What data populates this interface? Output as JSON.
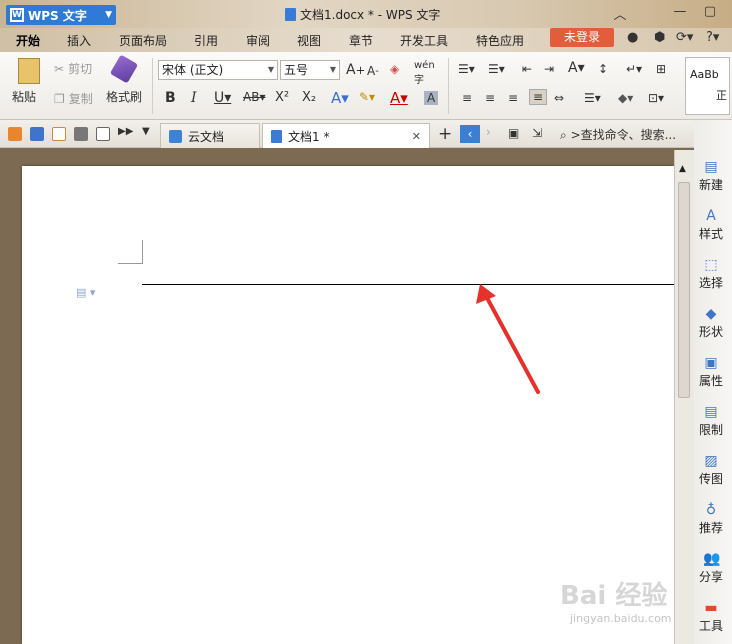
{
  "app": {
    "name": "WPS 文字",
    "window_title": "文档1.docx * - WPS 文字"
  },
  "menu": {
    "tabs": [
      "开始",
      "插入",
      "页面布局",
      "引用",
      "审阅",
      "视图",
      "章节",
      "开发工具",
      "特色应用"
    ],
    "login": "未登录"
  },
  "ribbon": {
    "paste": "粘贴",
    "cut": "剪切",
    "copy": "复制",
    "format_painter": "格式刷",
    "font_name": "宋体 (正文)",
    "font_size": "五号",
    "style_preview": "AaBb",
    "style_preview2": "正"
  },
  "quickbar": {
    "cloud_tab": "云文档",
    "doc_tab": "文档1 *",
    "search_placeholder": ">查找命令、搜索..."
  },
  "sidebar": {
    "items": [
      "新建",
      "样式",
      "选择",
      "形状",
      "属性",
      "限制",
      "传图",
      "推荐",
      "分享",
      "工具"
    ]
  },
  "watermark": {
    "brand": "Bai 经验",
    "url": "jingyan.baidu.com"
  },
  "colors": {
    "accent": "#2f7ad4",
    "login": "#e35d3d",
    "arrow": "#e8302a"
  }
}
